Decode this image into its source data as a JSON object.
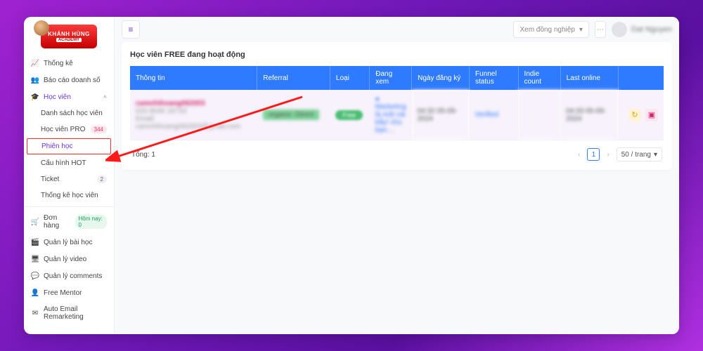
{
  "logo": {
    "line1": "KHÁNH HÙNG",
    "line2": "ACADEMY"
  },
  "sidebar": {
    "items": [
      {
        "icon": "📈",
        "label": "Thống kê"
      },
      {
        "icon": "👥",
        "label": "Báo cáo doanh số"
      },
      {
        "icon": "🎓",
        "label": "Học viên",
        "active": true,
        "chev": "˄"
      }
    ],
    "sub": [
      {
        "label": "Danh sách học viên"
      },
      {
        "label": "Học viên PRO",
        "badge": "344"
      },
      {
        "label": "Phiên học",
        "selected": true
      },
      {
        "label": "Cấu hình HOT"
      },
      {
        "label": "Ticket",
        "badge": "2",
        "gray": true
      },
      {
        "label": "Thống kê học viên"
      }
    ],
    "items2": [
      {
        "icon": "🛒",
        "label": "Đơn hàng",
        "badge": "Hôm nay: 0",
        "green": true
      },
      {
        "icon": "🎬",
        "label": "Quản lý bài học"
      },
      {
        "icon": "🖥",
        "label": "Quản lý video"
      },
      {
        "icon": "💬",
        "label": "Quản lý comments"
      },
      {
        "icon": "👤",
        "label": "Free Mentor"
      },
      {
        "icon": "✉",
        "label": "Auto Email Remarketing"
      }
    ]
  },
  "topbar": {
    "colleagues": "Xem đồng nghiệp",
    "username": "Dat Nguyen"
  },
  "card": {
    "title": "Học viên FREE đang hoạt động"
  },
  "table": {
    "headers": [
      "Thông tin",
      "Referral",
      "Loại",
      "Đang xem",
      "Ngày đăng ký",
      "Funnel status",
      "Indie count",
      "Last online",
      ""
    ],
    "row": {
      "info_line1": "camnhihoang062003",
      "info_line2": "033 8046 18733",
      "info_line3": "Email: camnhihoang062003@gmail.com",
      "referral": "organic: Direct",
      "type": "Free",
      "watching": "● Marketing là một cái bẫy! cho bạn…",
      "reg": "04:32 05-09-2024",
      "funnel": "Verified",
      "indie": "",
      "last": "04:33 05-09-2024"
    },
    "total_label": "Tổng:",
    "total_value": "1",
    "page": "1",
    "pagesize": "50 / trang"
  }
}
